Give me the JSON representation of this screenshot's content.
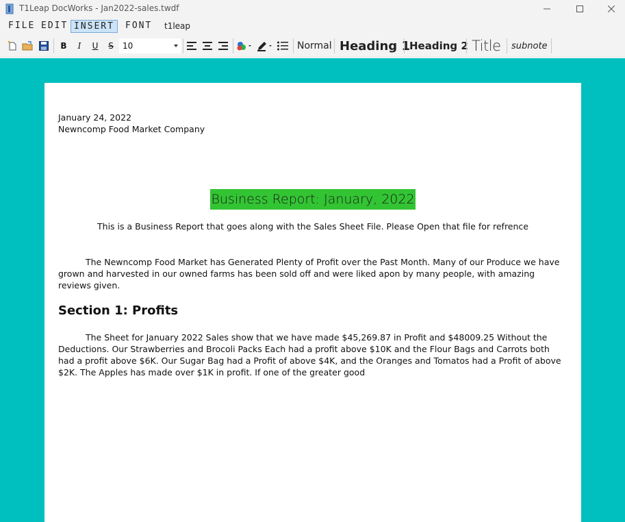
{
  "window": {
    "title": "T1Leap DocWorks - Jan2022-sales.twdf",
    "minimize_glyph": "—",
    "maximize_glyph": "☐",
    "close_glyph": "✕"
  },
  "menu": {
    "file": "FILE",
    "edit": "EDIT",
    "insert": "INSERT",
    "font": "FONT",
    "t1leap": "t1leap"
  },
  "toolbar": {
    "bold": "B",
    "italic": "I",
    "underline": "U",
    "strike": "S",
    "font_size": "10",
    "styles": {
      "normal": "Normal",
      "heading1": "Heading 1",
      "heading2": "Heading 2",
      "title": "Title",
      "subnote": "subnote"
    }
  },
  "document": {
    "date": "January 24, 2022",
    "company": "Newncomp Food Market Company",
    "heading": "Business Report: January, 2022",
    "subtitle": "This is a Business Report that goes along with the Sales Sheet File. Please Open that file for refrence",
    "paragraph1": "The Newncomp Food Market has Generated Plenty of Profit over the Past Month. Many of our Produce we have grown and harvested in our owned farms has been sold off and were liked apon by many people, with amazing reviews given.",
    "section1_heading": "Section 1: Profits",
    "paragraph2": "The Sheet for January 2022 Sales show that we have made $45,269.87 in Profit and $48009.25 Without the Deductions. Our Strawberries and Brocoli Packs Each had a profit above $10K and the Flour Bags and Carrots both had a profit above $6K. Our Sugar Bag had a Profit of above $4K, and the Oranges and Tomatos had a Profit of above $2K. The Apples has made over $1K in profit. If one of the greater good"
  },
  "colors": {
    "workspace": "#00bfbf",
    "heading_highlight": "#33c433",
    "menu_active": "#cce4f7"
  },
  "icons": [
    "app-icon",
    "new-document-icon",
    "open-folder-icon",
    "save-icon",
    "align-left-icon",
    "align-center-icon",
    "align-right-icon",
    "fill-color-icon",
    "pen-color-icon",
    "bullet-list-icon"
  ]
}
